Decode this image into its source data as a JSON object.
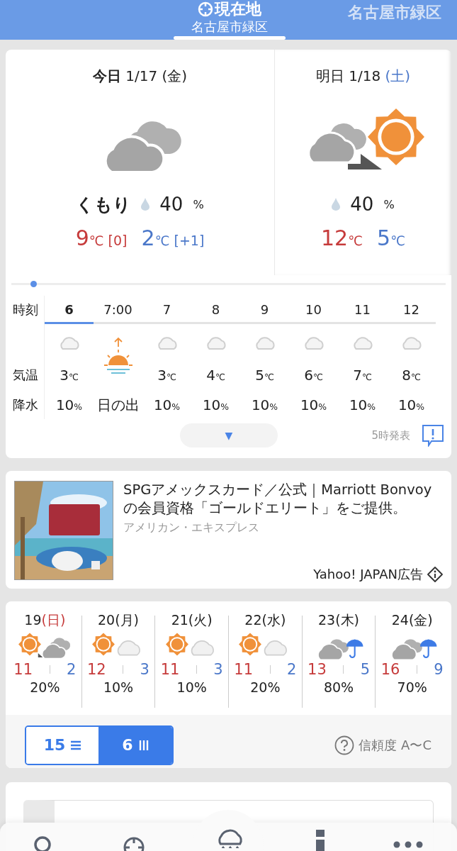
{
  "header": {
    "tabs": [
      {
        "title": "現在地",
        "subtitle": "名古屋市緑区",
        "selected": true
      },
      {
        "title": "名古屋市緑区",
        "selected": false
      }
    ]
  },
  "forecast": {
    "days": [
      {
        "label": "今日",
        "date": "1/17",
        "weekday": "(金)",
        "color": "#222222",
        "selected": true,
        "kind": "cloudy",
        "condition": "くもり",
        "precip": "40",
        "precip_unit": "%",
        "high": "9",
        "high_unit": "℃",
        "high_diff": "[0]",
        "low": "2",
        "low_unit": "℃",
        "low_diff": "[+1]"
      },
      {
        "label": "明日",
        "date": "1/18",
        "weekday": "(土)",
        "color": "#4a77c9",
        "selected": false,
        "kind": "cloud-then-sun",
        "precip": "40",
        "precip_unit": "%",
        "high": "12",
        "high_unit": "℃",
        "low": "5",
        "low_unit": "℃"
      }
    ],
    "hourly": {
      "row_labels": [
        "時刻",
        "気温",
        "降水"
      ],
      "slider": {
        "level": 0.05
      },
      "hours": [
        {
          "kind": "hour",
          "time": "6",
          "selected": true,
          "temp": "3",
          "temp_unit": "℃",
          "precip": "10",
          "precip_unit": "%"
        },
        {
          "kind": "sunrise",
          "time": "7:00",
          "selected": false,
          "label": "日の出"
        },
        {
          "kind": "hour",
          "time": "7",
          "selected": false,
          "temp": "3",
          "temp_unit": "℃",
          "precip": "10",
          "precip_unit": "%"
        },
        {
          "kind": "hour",
          "time": "8",
          "selected": false,
          "temp": "4",
          "temp_unit": "℃",
          "precip": "10",
          "precip_unit": "%"
        },
        {
          "kind": "hour",
          "time": "9",
          "selected": false,
          "temp": "5",
          "temp_unit": "℃",
          "precip": "10",
          "precip_unit": "%"
        },
        {
          "kind": "hour",
          "time": "10",
          "selected": false,
          "temp": "6",
          "temp_unit": "℃",
          "precip": "10",
          "precip_unit": "%"
        },
        {
          "kind": "hour",
          "time": "11",
          "selected": false,
          "temp": "7",
          "temp_unit": "℃",
          "precip": "10",
          "precip_unit": "%"
        },
        {
          "kind": "hour",
          "time": "12",
          "selected": false,
          "temp": "8",
          "temp_unit": "℃",
          "precip": "10",
          "precip_unit": "%"
        }
      ]
    },
    "expand_button": "▼",
    "issued": "5時発表"
  },
  "ad": {
    "title": "SPGアメックスカード／公式｜Marriott Bonvoyの会員資格「ゴールドエリート」をご提供。",
    "advertiser": "アメリカン・エキスプレス",
    "label": "Yahoo! JAPAN広告"
  },
  "weekly": {
    "days": [
      {
        "date": "19",
        "weekday": "(日)",
        "color": "#c63b3b",
        "kind": "sun-then-cloud",
        "high": "11",
        "low": "2",
        "precip": "20%"
      },
      {
        "date": "20",
        "weekday": "(月)",
        "color": "#222222",
        "kind": "sun-cloud",
        "high": "12",
        "low": "3",
        "precip": "10%"
      },
      {
        "date": "21",
        "weekday": "(火)",
        "color": "#222222",
        "kind": "sun-cloud",
        "high": "11",
        "low": "3",
        "precip": "10%"
      },
      {
        "date": "22",
        "weekday": "(水)",
        "color": "#222222",
        "kind": "sun-cloud",
        "high": "11",
        "low": "2",
        "precip": "20%"
      },
      {
        "date": "23",
        "weekday": "(木)",
        "color": "#222222",
        "kind": "cloud-rain",
        "high": "13",
        "low": "5",
        "precip": "80%"
      },
      {
        "date": "24",
        "weekday": "(金)",
        "color": "#222222",
        "kind": "cloud-rain",
        "high": "16",
        "low": "9",
        "precip": "70%"
      }
    ],
    "toggle": [
      {
        "label": "15",
        "selected": false
      },
      {
        "label": "6",
        "selected": true
      }
    ],
    "reliability": "信頼度 A〜C"
  }
}
